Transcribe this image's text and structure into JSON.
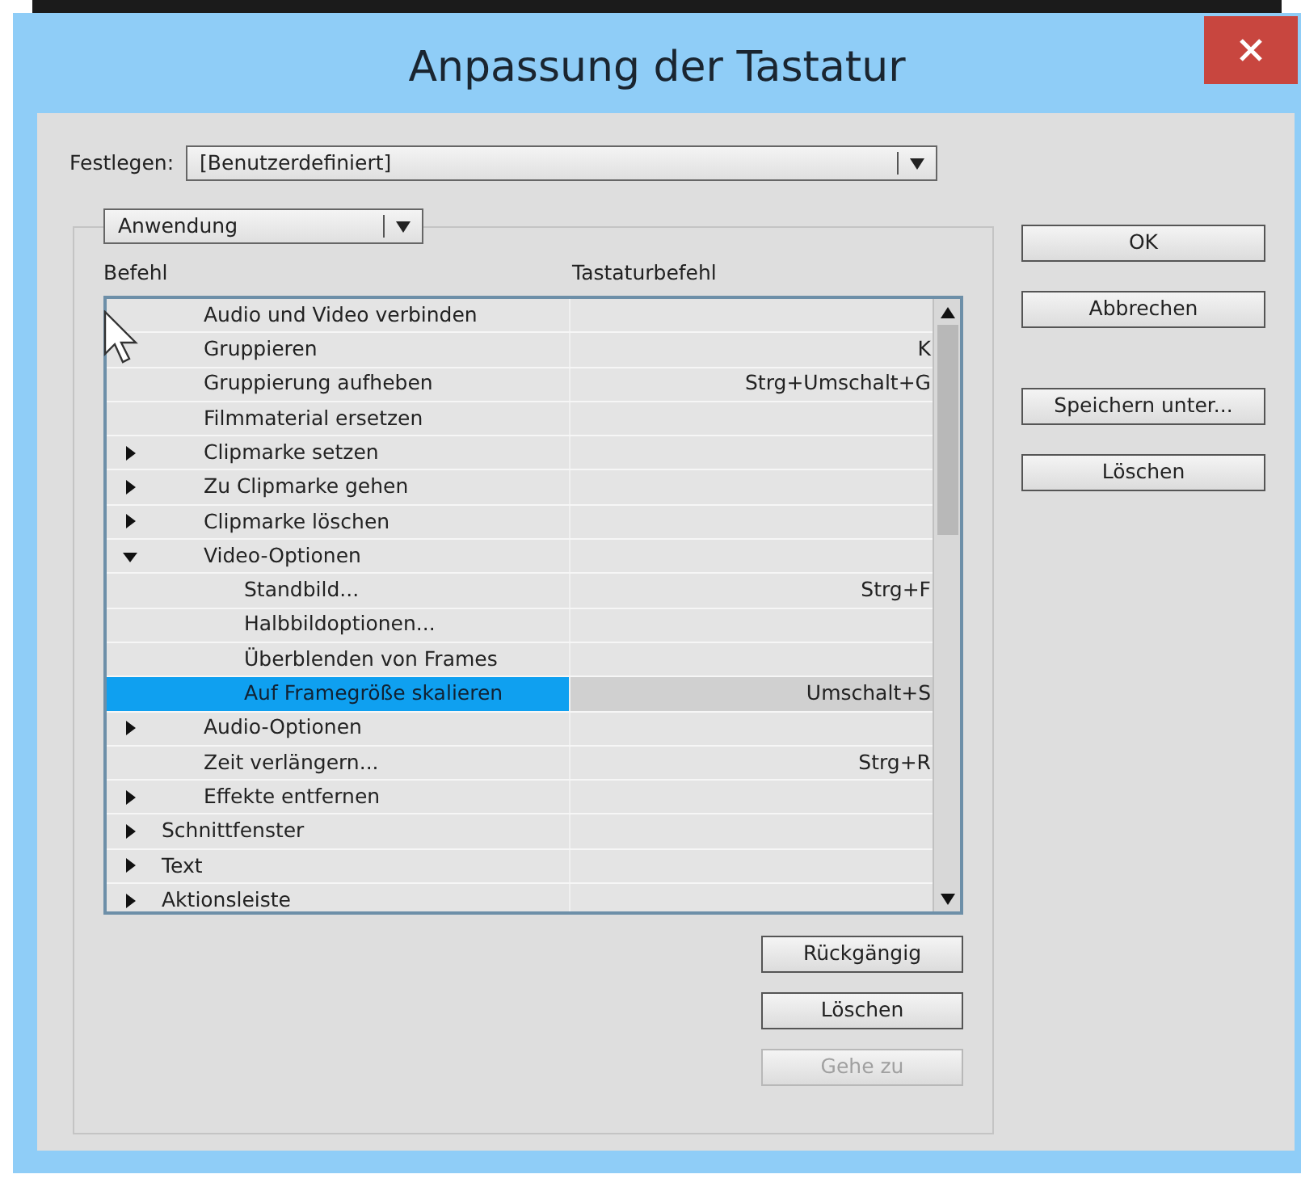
{
  "window": {
    "title": "Anpassung der Tastatur"
  },
  "preset": {
    "label": "Festlegen:",
    "value": "[Benutzerdefiniert]"
  },
  "category": {
    "value": "Anwendung"
  },
  "columns": [
    "Befehl",
    "Tastaturbefehl"
  ],
  "tree": {
    "partial_group": [
      {
        "label": "Audio und Video verbinden",
        "selected": false
      },
      {
        "label": "Gruppieren",
        "shortcut": "K",
        "selected": false
      },
      {
        "label": "Gruppierung aufheben",
        "shortcut": "Strg+Umschalt+G",
        "selected": false
      },
      {
        "label": "Filmmaterial ersetzen",
        "selected": false
      },
      {
        "label": "Clipmarke setzen",
        "expanded": false,
        "selected": false
      },
      {
        "label": "Zu Clipmarke gehen",
        "expanded": false,
        "selected": false
      },
      {
        "label": "Clipmarke löschen",
        "expanded": false,
        "selected": false
      },
      {
        "label": "Video-Optionen",
        "expanded": true,
        "selected": false,
        "children": [
          {
            "label": "Standbild...",
            "shortcut": "Strg+F",
            "selected": false
          },
          {
            "label": "Halbbildoptionen...",
            "selected": false
          },
          {
            "label": "Überblenden von Frames",
            "selected": false
          },
          {
            "label": "Auf Framegröße skalieren",
            "shortcut": "Umschalt+S",
            "selected": true
          }
        ]
      },
      {
        "label": "Audio-Optionen",
        "expanded": false,
        "selected": false
      },
      {
        "label": "Zeit verlängern...",
        "shortcut": "Strg+R",
        "selected": false
      },
      {
        "label": "Effekte entfernen",
        "expanded": false,
        "selected": false
      }
    ],
    "items": [
      {
        "label": "Schnittfenster",
        "expanded": false,
        "selected": false
      },
      {
        "label": "Text",
        "expanded": false,
        "selected": false
      },
      {
        "label": "Aktionsleiste",
        "expanded": false,
        "selected": false
      }
    ]
  },
  "list_buttons": [
    {
      "label": "Rückgängig",
      "disabled": false
    },
    {
      "label": "Löschen",
      "disabled": false
    },
    {
      "label": "Gehe zu",
      "disabled": true
    }
  ],
  "dialog_buttons": [
    {
      "label": "OK"
    },
    {
      "label": "Abbrechen"
    },
    {
      "label": "Speichern unter..."
    },
    {
      "label": "Löschen"
    }
  ]
}
